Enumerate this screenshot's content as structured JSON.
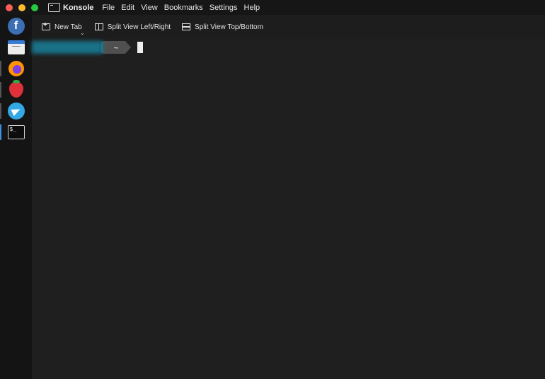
{
  "menubar": {
    "app_name": "Konsole",
    "items": [
      "File",
      "Edit",
      "View",
      "Bookmarks",
      "Settings",
      "Help"
    ]
  },
  "dock": {
    "items": [
      {
        "name": "fedora-icon",
        "glyph": "f"
      },
      {
        "name": "files-icon"
      },
      {
        "name": "firefox-icon"
      },
      {
        "name": "strawberry-icon"
      },
      {
        "name": "telegram-icon"
      },
      {
        "name": "terminal-icon",
        "glyph": "$_",
        "active": true
      }
    ]
  },
  "toolbar": {
    "new_tab_label": "New Tab",
    "split_lr_label": "Split View Left/Right",
    "split_tb_label": "Split View Top/Bottom"
  },
  "terminal": {
    "prompt_dir": "~"
  },
  "colors": {
    "accent": "#3d8fe8",
    "prompt_user_bg": "#197a92",
    "prompt_dir_bg": "#505050"
  }
}
